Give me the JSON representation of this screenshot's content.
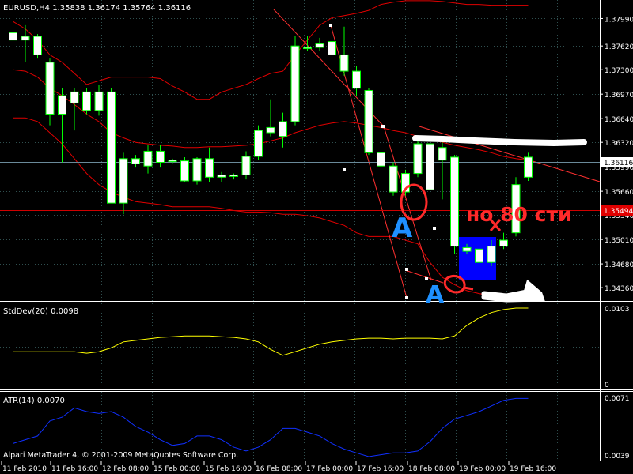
{
  "header": {
    "title": "EURUSD,H4  1.35838 1.36174 1.35764 1.36116"
  },
  "price_tags": {
    "current": "1.36116",
    "level": "1.35494"
  },
  "footer": {
    "copyright": "Alpari MetaTrader 4, © 2001-2009 MetaQuotes Software Corp."
  },
  "panels": {
    "stddev": {
      "label": "StdDev(20) 0.0098",
      "top_tick": "0.0103",
      "bottom_tick": "0"
    },
    "atr": {
      "label": "ATR(14) 0.0070",
      "top_tick": "0.0071",
      "bottom_tick": "0.0039"
    }
  },
  "annotations": {
    "letter_a": "A",
    "letter_a2": "A",
    "russian_text": "но 80 сти"
  },
  "colors": {
    "background": "#000000",
    "grid": "#2f4f4f",
    "bull": "#ffffff",
    "bear": "#ffffff",
    "candle_outline": "#00ff00",
    "bands": "#ff0000",
    "stddev": "#ffff00",
    "atr": "#0000ff",
    "annot_blue": "#1e90ff",
    "annot_red": "#ff2a2a",
    "box_blue": "#0000ff"
  },
  "chart_data": {
    "type": "candlestick",
    "symbol": "EURUSD",
    "timeframe": "H4",
    "y_ticks": [
      "1.37990",
      "1.37620",
      "1.37300",
      "1.36970",
      "1.36640",
      "1.36320",
      "1.35990",
      "1.35660",
      "1.35340",
      "1.35010",
      "1.34680",
      "1.34360"
    ],
    "ylim": [
      1.3418,
      1.3824
    ],
    "x_ticks": [
      "11 Feb 2010",
      "11 Feb 16:00",
      "12 Feb 08:00",
      "15 Feb 00:00",
      "15 Feb 16:00",
      "16 Feb 08:00",
      "17 Feb 00:00",
      "17 Feb 16:00",
      "18 Feb 08:00",
      "19 Feb 00:00",
      "19 Feb 16:00"
    ],
    "candles": [
      {
        "o": 1.378,
        "h": 1.3815,
        "l": 1.3758,
        "c": 1.377
      },
      {
        "o": 1.377,
        "h": 1.379,
        "l": 1.374,
        "c": 1.3775
      },
      {
        "o": 1.3775,
        "h": 1.3778,
        "l": 1.3745,
        "c": 1.375
      },
      {
        "o": 1.374,
        "h": 1.3745,
        "l": 1.3655,
        "c": 1.367
      },
      {
        "o": 1.367,
        "h": 1.3705,
        "l": 1.3605,
        "c": 1.3695
      },
      {
        "o": 1.3685,
        "h": 1.3705,
        "l": 1.3648,
        "c": 1.37
      },
      {
        "o": 1.37,
        "h": 1.3705,
        "l": 1.367,
        "c": 1.3675
      },
      {
        "o": 1.3675,
        "h": 1.371,
        "l": 1.3668,
        "c": 1.37
      },
      {
        "o": 1.37,
        "h": 1.3705,
        "l": 1.355,
        "c": 1.355
      },
      {
        "o": 1.355,
        "h": 1.3618,
        "l": 1.3535,
        "c": 1.361
      },
      {
        "o": 1.3603,
        "h": 1.3615,
        "l": 1.3598,
        "c": 1.361
      },
      {
        "o": 1.36,
        "h": 1.3628,
        "l": 1.359,
        "c": 1.362
      },
      {
        "o": 1.362,
        "h": 1.3628,
        "l": 1.3598,
        "c": 1.3605
      },
      {
        "o": 1.3606,
        "h": 1.361,
        "l": 1.3604,
        "c": 1.3608
      },
      {
        "o": 1.3607,
        "h": 1.3612,
        "l": 1.3578,
        "c": 1.358
      },
      {
        "o": 1.358,
        "h": 1.3612,
        "l": 1.3575,
        "c": 1.361
      },
      {
        "o": 1.361,
        "h": 1.3625,
        "l": 1.3578,
        "c": 1.3585
      },
      {
        "o": 1.3585,
        "h": 1.3592,
        "l": 1.3578,
        "c": 1.3588
      },
      {
        "o": 1.3586,
        "h": 1.359,
        "l": 1.3582,
        "c": 1.3588
      },
      {
        "o": 1.3588,
        "h": 1.362,
        "l": 1.3582,
        "c": 1.3613
      },
      {
        "o": 1.3613,
        "h": 1.3655,
        "l": 1.3608,
        "c": 1.3648
      },
      {
        "o": 1.3645,
        "h": 1.369,
        "l": 1.364,
        "c": 1.3652
      },
      {
        "o": 1.364,
        "h": 1.3672,
        "l": 1.3625,
        "c": 1.366
      },
      {
        "o": 1.366,
        "h": 1.3775,
        "l": 1.3655,
        "c": 1.3762
      },
      {
        "o": 1.376,
        "h": 1.3775,
        "l": 1.3755,
        "c": 1.376
      },
      {
        "o": 1.376,
        "h": 1.3773,
        "l": 1.3755,
        "c": 1.3765
      },
      {
        "o": 1.3768,
        "h": 1.3772,
        "l": 1.3748,
        "c": 1.375
      },
      {
        "o": 1.375,
        "h": 1.3788,
        "l": 1.3722,
        "c": 1.3728
      },
      {
        "o": 1.3728,
        "h": 1.3735,
        "l": 1.3695,
        "c": 1.3705
      },
      {
        "o": 1.3702,
        "h": 1.3705,
        "l": 1.3615,
        "c": 1.3618
      },
      {
        "o": 1.3618,
        "h": 1.3628,
        "l": 1.3595,
        "c": 1.36
      },
      {
        "o": 1.36,
        "h": 1.3605,
        "l": 1.356,
        "c": 1.3565
      },
      {
        "o": 1.3565,
        "h": 1.3595,
        "l": 1.356,
        "c": 1.359
      },
      {
        "o": 1.359,
        "h": 1.3635,
        "l": 1.3585,
        "c": 1.363
      },
      {
        "o": 1.363,
        "h": 1.3635,
        "l": 1.356,
        "c": 1.3568
      },
      {
        "o": 1.3608,
        "h": 1.3632,
        "l": 1.3555,
        "c": 1.3625
      },
      {
        "o": 1.3612,
        "h": 1.3615,
        "l": 1.3482,
        "c": 1.3492
      },
      {
        "o": 1.3485,
        "h": 1.3495,
        "l": 1.3482,
        "c": 1.349
      },
      {
        "o": 1.347,
        "h": 1.3492,
        "l": 1.3465,
        "c": 1.3488
      },
      {
        "o": 1.347,
        "h": 1.35,
        "l": 1.3465,
        "c": 1.3492
      },
      {
        "o": 1.3492,
        "h": 1.351,
        "l": 1.3488,
        "c": 1.35
      },
      {
        "o": 1.351,
        "h": 1.3585,
        "l": 1.3505,
        "c": 1.3575
      },
      {
        "o": 1.3585,
        "h": 1.3618,
        "l": 1.358,
        "c": 1.3612
      }
    ],
    "hlines": [
      1.36116,
      1.35494
    ],
    "stddev": {
      "name": "StdDev(20)",
      "last": 0.0098,
      "ylim": [
        0,
        0.0103
      ],
      "values": [
        0.0045,
        0.0045,
        0.0045,
        0.0045,
        0.0045,
        0.0045,
        0.0043,
        0.0045,
        0.005,
        0.0058,
        0.006,
        0.0062,
        0.0064,
        0.0065,
        0.0066,
        0.0066,
        0.0066,
        0.0065,
        0.0064,
        0.0062,
        0.0058,
        0.0048,
        0.004,
        0.0045,
        0.005,
        0.0055,
        0.0058,
        0.006,
        0.0062,
        0.0063,
        0.0063,
        0.0062,
        0.0063,
        0.0063,
        0.0063,
        0.0062,
        0.0066,
        0.008,
        0.009,
        0.0097,
        0.0101,
        0.0103,
        0.0103
      ]
    },
    "atr": {
      "name": "ATR(14)",
      "last": 0.007,
      "ylim": [
        0.0039,
        0.0071
      ],
      "values": [
        0.0046,
        0.0048,
        0.005,
        0.0058,
        0.006,
        0.0065,
        0.0063,
        0.0062,
        0.0063,
        0.006,
        0.0055,
        0.0052,
        0.0048,
        0.0045,
        0.0046,
        0.005,
        0.005,
        0.0048,
        0.0044,
        0.0042,
        0.0044,
        0.0048,
        0.0054,
        0.0054,
        0.0052,
        0.005,
        0.0046,
        0.0043,
        0.0041,
        0.0039,
        0.004,
        0.0041,
        0.0041,
        0.0042,
        0.0047,
        0.0054,
        0.0059,
        0.0061,
        0.0063,
        0.0066,
        0.0069,
        0.007,
        0.007
      ]
    },
    "bands": {
      "upper": [
        1.3795,
        1.3785,
        1.377,
        1.375,
        1.374,
        1.3725,
        1.371,
        1.3715,
        1.372,
        1.372,
        1.372,
        1.372,
        1.3718,
        1.3708,
        1.37,
        1.369,
        1.369,
        1.37,
        1.3705,
        1.371,
        1.3718,
        1.3725,
        1.3728,
        1.375,
        1.377,
        1.379,
        1.38,
        1.3803,
        1.3806,
        1.381,
        1.3818,
        1.3821,
        1.3823,
        1.3823,
        1.3823,
        1.3822,
        1.382,
        1.3818,
        1.3818,
        1.3817,
        1.3817,
        1.3817,
        1.3817
      ],
      "middle": [
        1.373,
        1.3728,
        1.372,
        1.3705,
        1.3695,
        1.3683,
        1.367,
        1.366,
        1.3645,
        1.3638,
        1.3632,
        1.363,
        1.3628,
        1.3627,
        1.3625,
        1.3625,
        1.3626,
        1.3626,
        1.3627,
        1.3628,
        1.363,
        1.3634,
        1.3638,
        1.3645,
        1.365,
        1.3655,
        1.3658,
        1.366,
        1.3658,
        1.3655,
        1.3652,
        1.3648,
        1.3645,
        1.364,
        1.3636,
        1.3632,
        1.3628,
        1.3625,
        1.3622,
        1.3618,
        1.3613,
        1.361,
        1.3608
      ],
      "lower": [
        1.3665,
        1.3665,
        1.366,
        1.3645,
        1.363,
        1.361,
        1.359,
        1.3575,
        1.3565,
        1.3558,
        1.3552,
        1.355,
        1.3548,
        1.3545,
        1.3545,
        1.3545,
        1.3545,
        1.3543,
        1.354,
        1.3538,
        1.3538,
        1.3537,
        1.3535,
        1.3535,
        1.3533,
        1.353,
        1.3525,
        1.352,
        1.351,
        1.3505,
        1.3505,
        1.3505,
        1.35,
        1.3495,
        1.347,
        1.345,
        1.344,
        1.3432,
        1.3428,
        1.3425,
        1.342,
        1.3418,
        1.3418
      ]
    }
  }
}
